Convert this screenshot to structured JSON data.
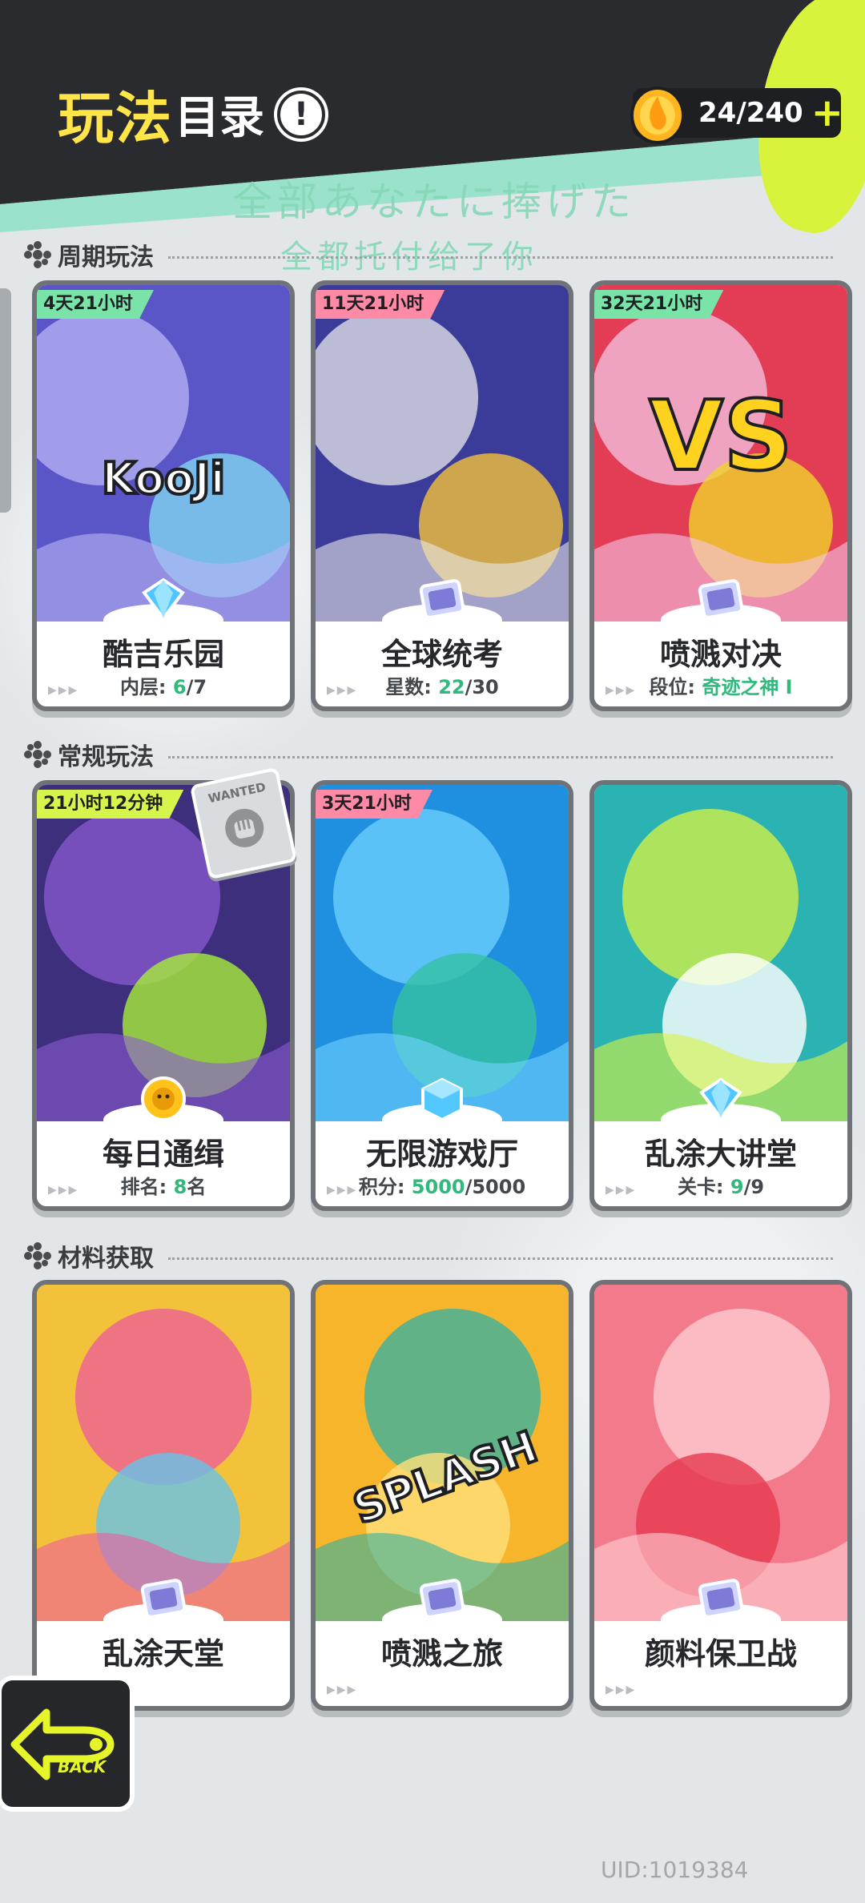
{
  "header": {
    "title_a": "玩法",
    "title_b": "目录",
    "info_icon": "!",
    "currency_value": "24/240",
    "plus": "+"
  },
  "watermark": {
    "line1": "全部あなたに捧げた",
    "line2": "全都托付给了你"
  },
  "sections": {
    "periodic": "周期玩法",
    "regular": "常规玩法",
    "materials": "材料获取"
  },
  "cards": [
    {
      "name": "酷吉乐园",
      "badge": "4天21小时",
      "badge_color": "green",
      "stat_label": "内层: ",
      "stat_value": "6",
      "stat_total": "/7",
      "art_text": "KooJi",
      "icon": "diamond-icon",
      "colors": [
        "#5a56c8",
        "#b9b5f5",
        "#7fd3f0"
      ]
    },
    {
      "name": "全球统考",
      "badge": "11天21小时",
      "badge_color": "pink",
      "stat_label": "星数: ",
      "stat_value": "22",
      "stat_total": "/30",
      "icon": "ticket-icon",
      "colors": [
        "#3b3b9a",
        "#e8e8ea",
        "#f2c23a"
      ]
    },
    {
      "name": "喷溅对决",
      "badge": "32天21小时",
      "badge_color": "green",
      "stat_label": "段位: ",
      "stat_value": "奇迹之神 I",
      "stat_total": "",
      "art_text": "VS",
      "icon": "ticket-icon",
      "colors": [
        "#e23d55",
        "#f3c5e6",
        "#f1d22c"
      ]
    },
    {
      "name": "每日通缉",
      "badge": "21小时12分钟",
      "badge_color": "lime",
      "stat_label": "排名: ",
      "stat_value": "8",
      "stat_total": "名",
      "icon": "lion-coin-icon",
      "colors": [
        "#3e2f7c",
        "#8a5bd2",
        "#a7ec3a"
      ]
    },
    {
      "name": "无限游戏厅",
      "badge": "3天21小时",
      "badge_color": "pink",
      "stat_label": "积分: ",
      "stat_value": "5000",
      "stat_total": "/5000",
      "icon": "cube-icon",
      "colors": [
        "#1f8fe0",
        "#6fd3ff",
        "#35c2a3"
      ]
    },
    {
      "name": "乱涂大讲堂",
      "badge": "",
      "badge_color": "",
      "stat_label": "关卡: ",
      "stat_value": "9",
      "stat_total": "/9",
      "icon": "diamond-icon",
      "colors": [
        "#2bb3b4",
        "#d9f340",
        "#ffffff"
      ]
    },
    {
      "name": "乱涂天堂",
      "badge": "",
      "badge_color": "",
      "stat_label": "",
      "stat_value": "",
      "stat_total": "",
      "icon": "ticket-icon",
      "colors": [
        "#f2c23a",
        "#ee5a9c",
        "#66c3ea"
      ]
    },
    {
      "name": "喷溅之旅",
      "badge": "",
      "badge_color": "",
      "stat_label": "",
      "stat_value": "",
      "stat_total": "",
      "art_text": "SPLASH",
      "icon": "ticket-icon",
      "colors": [
        "#f7b52c",
        "#2fb2a4",
        "#ffe07a"
      ]
    },
    {
      "name": "颜料保卫战",
      "badge": "",
      "badge_color": "",
      "stat_label": "",
      "stat_value": "",
      "stat_total": "",
      "icon": "ticket-icon",
      "colors": [
        "#f27a8a",
        "#ffd1d6",
        "#e63a4f"
      ]
    }
  ],
  "wanted_tag": "WANTED",
  "back_button": "BACK",
  "uid": "UID:1019384",
  "colors": {
    "header_bg": "#2a2b2f",
    "title_yellow": "#ffe548",
    "accent_lime": "#e6f52a",
    "mint": "#8de0c6",
    "stat_green": "#2fb97c"
  }
}
